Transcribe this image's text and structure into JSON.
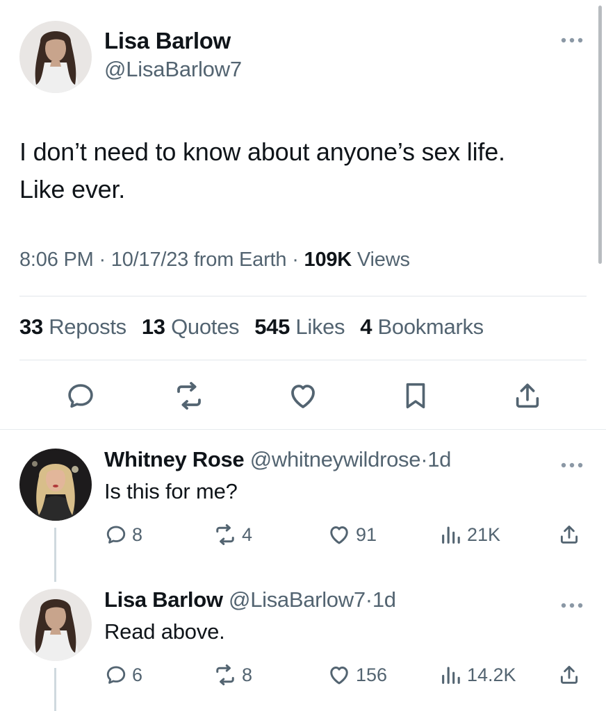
{
  "main_tweet": {
    "author_name": "Lisa Barlow",
    "author_handle": "@LisaBarlow7",
    "more_icon": "more-horizontal-icon",
    "text_line1": "I don’t need to know about anyone’s sex life.",
    "text_line2": "Like ever.",
    "time": "8:06 PM",
    "date": "10/17/23",
    "source": "from Earth",
    "views_count": "109K",
    "views_label": "Views",
    "reposts_count": "33",
    "reposts_label": "Reposts",
    "quotes_count": "13",
    "quotes_label": "Quotes",
    "likes_count": "545",
    "likes_label": "Likes",
    "bookmarks_count": "4",
    "bookmarks_label": "Bookmarks"
  },
  "separator": "·",
  "replies": [
    {
      "author_name": "Whitney Rose",
      "author_handle": "@whitneywildrose",
      "time": "1d",
      "text": "Is this for me?",
      "replies_count": "8",
      "reposts_count": "4",
      "likes_count": "91",
      "views_count": "21K"
    },
    {
      "author_name": "Lisa Barlow",
      "author_handle": "@LisaBarlow7",
      "time": "1d",
      "text": "Read above.",
      "replies_count": "6",
      "reposts_count": "8",
      "likes_count": "156",
      "views_count": "14.2K"
    }
  ],
  "colors": {
    "text_primary": "#0f1419",
    "text_secondary": "#536471",
    "divider": "#e1e6ea",
    "thread_line": "#cfd9de"
  }
}
